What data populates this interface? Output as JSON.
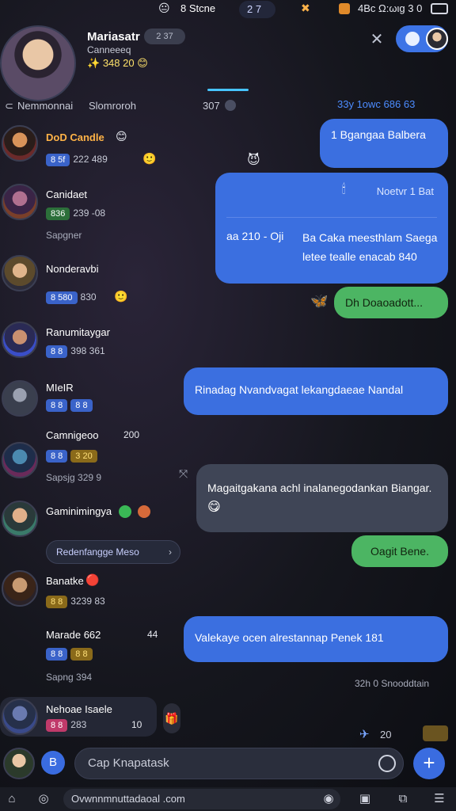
{
  "status_bar": {
    "left_label": "8 Stcne",
    "pill_label": "2 7",
    "right_label": "4Bc Ω:ωιg 3 0"
  },
  "header": {
    "name": "Mariasatr",
    "badge": "2 37",
    "subtitle": "Canneeeq",
    "stats": "348 20"
  },
  "section": {
    "left_a": "Nemmonnai",
    "left_b": "Slomroroh",
    "mid": "307",
    "right": "33y 1owc 686 63"
  },
  "contacts": [
    {
      "name": "DoD Candle",
      "meta": [
        "8 5f",
        "222 489"
      ],
      "highlight": true
    },
    {
      "name": "Canidaet",
      "meta": [
        "836",
        "239 -08"
      ],
      "sub": "Sapgner"
    },
    {
      "name": "Nonderavbi",
      "meta": [
        "8 580",
        "830"
      ]
    },
    {
      "name": "Ranumitaygar",
      "meta": [
        "8 8",
        "398 361"
      ]
    },
    {
      "name": "MIeIR",
      "meta": [
        "8 8",
        "8 8"
      ]
    },
    {
      "name": "Camnigeoo",
      "meta": [
        "8 8",
        "3 20"
      ],
      "sub": "Sapsjg 329 9",
      "extra": "200"
    },
    {
      "name": "Gaminimingya",
      "search": "Redenfangge Meso"
    },
    {
      "name": "Banatke",
      "meta": [
        "8 8",
        "3239 83"
      ]
    },
    {
      "name": "Marade 662",
      "meta": [
        "8 8",
        "8 8"
      ],
      "sub": "Sapng 394",
      "extra": "44"
    },
    {
      "name": "Nehoae Isaele",
      "meta": [
        "8 8",
        "283"
      ],
      "extra": "10"
    }
  ],
  "messages": [
    {
      "side": "right",
      "style": "blue",
      "text": "1 Bgangaa Balbera"
    },
    {
      "side": "right",
      "style": "blue",
      "title": "Noetvr 1 Bat",
      "text": "Ba Caka meesthlam Saega letee tealle enacab 840",
      "lead": "aa 210 - Oji"
    },
    {
      "side": "right",
      "style": "green",
      "text": "Dh Doaoadott..."
    },
    {
      "side": "right",
      "style": "blue",
      "text": "Rinadag Nvandvagat lekangdaeae Nandal"
    },
    {
      "side": "left",
      "style": "gray",
      "text": "Magaitgakana achl inalanegodankan Biangar."
    },
    {
      "side": "right",
      "style": "green",
      "text": "Oagit Bene."
    },
    {
      "side": "right",
      "style": "blue",
      "text": "Valekaye   ocen alrestannap Penek 181"
    }
  ],
  "footer_note": "32h 0 Snooddtain",
  "misc": {
    "counter_right": "20"
  },
  "composer": {
    "placeholder": "Cap Knapatask"
  },
  "url": {
    "value": "Ovwnnmnuttadaoal .com"
  }
}
